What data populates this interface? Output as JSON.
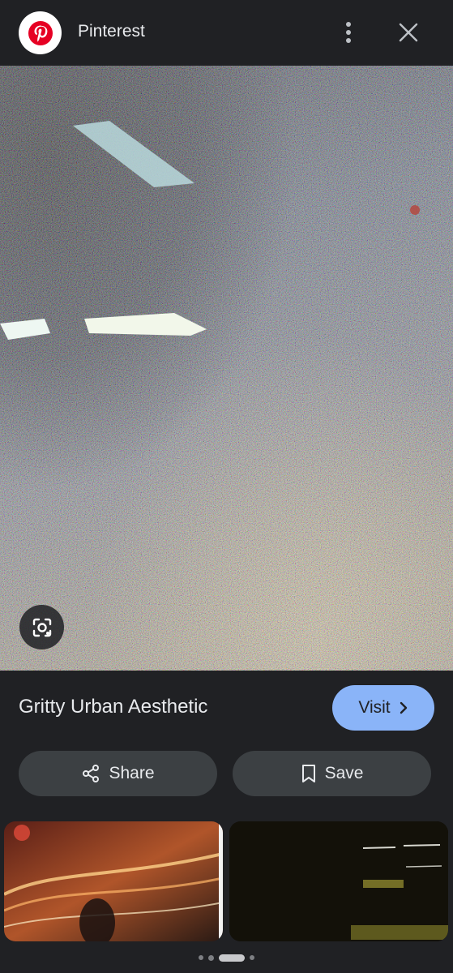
{
  "header": {
    "site_name": "Pinterest",
    "logo_icon": "pinterest-logo",
    "more_icon": "more-vert-icon",
    "close_icon": "close-icon"
  },
  "hero": {
    "lens_icon": "google-lens-icon"
  },
  "result": {
    "title": "Gritty Urban Aesthetic",
    "visit_label": "Visit"
  },
  "actions": {
    "share_label": "Share",
    "save_label": "Save"
  },
  "colors": {
    "background": "#202124",
    "accent": "#8ab4f8",
    "button": "#3c4043",
    "pinterest_red": "#e60023"
  },
  "pager": {
    "count": 4,
    "active_index": 2
  }
}
